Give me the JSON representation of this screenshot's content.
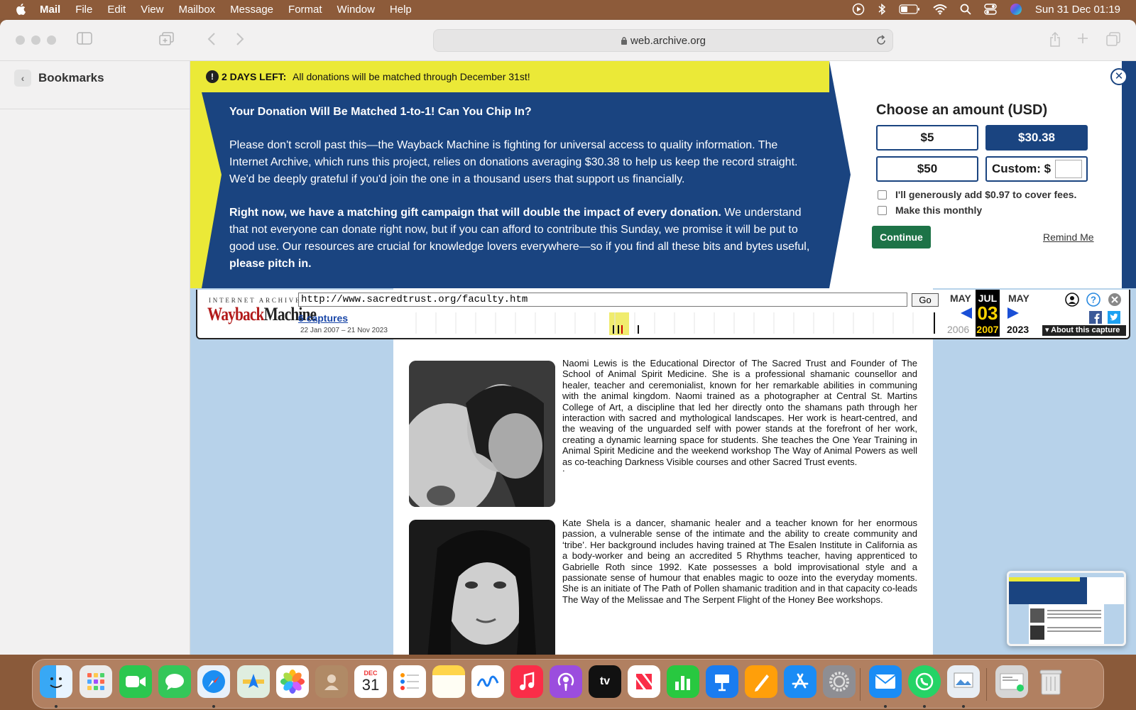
{
  "menubar": {
    "app_name": "Mail",
    "items": [
      "File",
      "Edit",
      "View",
      "Mailbox",
      "Message",
      "Format",
      "Window",
      "Help"
    ],
    "clock": "Sun 31 Dec  01:19",
    "status_icons": [
      "play-icon",
      "bluetooth-icon",
      "battery-icon",
      "wifi-icon",
      "search-icon",
      "control-center-icon",
      "siri-icon"
    ]
  },
  "browser": {
    "url": "web.archive.org",
    "secure_icon": "lock-icon"
  },
  "sidebar": {
    "title": "Bookmarks"
  },
  "banner": {
    "yellow_strong": "2 DAYS LEFT:",
    "yellow_msg": "All donations will be matched through December 31st!",
    "heading": "Your Donation Will Be Matched 1-to-1! Can You Chip In?",
    "para1": "Please don't scroll past this—the Wayback Machine is fighting for universal access to quality information. The Internet Archive, which runs this project, relies on donations averaging $30.38 to help us keep the record straight. We'd be deeply grateful if you'd join the one in a thousand users that support us financially.",
    "para2_bold": "Right now, we have a matching gift campaign that will double the impact of every donation.",
    "para2_rest": " We understand that not everyone can donate right now, but if you can afford to contribute this Sunday, we promise it will be put to good use. Our resources are crucial for knowledge lovers everywhere—so if you find all these bits and bytes useful, ",
    "para2_end": "please pitch in.",
    "amount_title": "Choose an amount (USD)",
    "amounts": [
      "$5",
      "$30.38",
      "$50"
    ],
    "custom_label": "Custom: $",
    "selected_amount": "$30.38",
    "fee_label": "I'll generously add $0.97 to cover fees.",
    "monthly_label": "Make this monthly",
    "continue_label": "Continue",
    "remind_label": "Remind Me",
    "colors": {
      "navy": "#1a4480",
      "yellow": "#ebe937",
      "green": "#1d7347"
    }
  },
  "wayback": {
    "ia_label": "INTERNET ARCHIVE",
    "logo_red": "Wayback",
    "logo_black": "Machine",
    "url_value": "http://www.sacredtrust.org/faculty.htm",
    "go_label": "Go",
    "captures_label": "6 captures",
    "date_range": "22 Jan 2007 – 21 Nov 2023",
    "prev_month": "MAY",
    "cur_month": "JUL",
    "next_month": "MAY",
    "cur_day": "03",
    "prev_year": "2006",
    "cur_year": "2007",
    "next_year": "2023",
    "about_label": "▾ About this capture"
  },
  "page": {
    "bio1": "Naomi Lewis is the Educational Director of The Sacred Trust and Founder of The School of Animal Spirit Medicine. She is a professional shamanic counsellor and healer, teacher and ceremonialist, known for her remarkable abilities in communing with the animal kingdom. Naomi trained as a photographer at Central St. Martins College of Art, a discipline that led her directly onto the shamans path through her interaction with sacred and mythological landscapes. Her work is heart-centred, and the weaving of the unguarded self with power stands at the forefront of her work, creating a dynamic learning space for students. She teaches the One Year Training in Animal Spirit Medicine and the weekend workshop The Way of Animal Powers as well as co-teaching Darkness Visible courses and other Sacred Trust events.",
    "dot": ".",
    "bio2": "Kate Shela is a dancer, shamanic healer and a teacher known for her enormous passion, a vulnerable sense of the intimate and the ability to create community and ‘tribe’. Her background includes having trained at The Esalen Institute in California as a body-worker and being an accredited 5 Rhythms teacher, having apprenticed to Gabrielle Roth since 1992. Kate possesses a bold improvisational style and a passionate sense of humour that enables magic to ooze into the everyday moments. She is an initiate of The Path of Pollen shamanic tradition and in that capacity co-leads The Way of the Melissae and The Serpent Flight of the Honey Bee workshops."
  },
  "dock": {
    "apps": [
      "Finder",
      "Launchpad",
      "FaceTime",
      "Messages",
      "Safari",
      "Maps",
      "Photos",
      "Contacts",
      "Calendar",
      "Reminders",
      "Notes",
      "Freeform",
      "Music",
      "Podcasts",
      "TV",
      "News",
      "Numbers",
      "Keynote",
      "Pages",
      "App Store",
      "System Settings",
      "Mail",
      "WhatsApp",
      "Preview",
      "Downloads",
      "Trash"
    ],
    "calendar_month": "DEC",
    "calendar_day": "31",
    "tv_label": "tv"
  }
}
